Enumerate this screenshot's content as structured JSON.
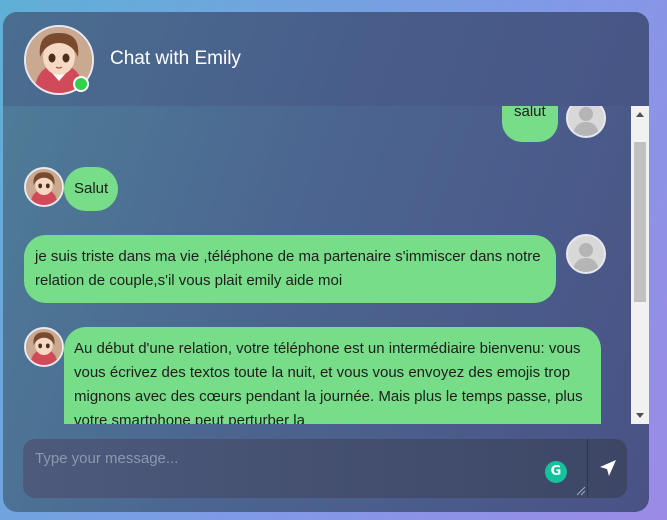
{
  "header": {
    "title": "Chat with Emily",
    "status": "online",
    "avatar_icon": "emily-avatar-icon"
  },
  "messages": [
    {
      "sender": "user",
      "text": "salut"
    },
    {
      "sender": "emily",
      "text": "Salut"
    },
    {
      "sender": "user",
      "text": "je suis triste dans ma vie ,téléphone de ma partenaire s'immiscer dans notre relation de couple,s'il vous plait emily aide moi"
    },
    {
      "sender": "emily",
      "text": "Au début d'une relation, votre téléphone est un intermédiaire bienvenu: vous vous écrivez des textos toute la nuit, et vous vous envoyez des emojis trop mignons avec des cœurs pendant la journée. Mais plus le temps passe, plus votre smartphone peut perturber la"
    }
  ],
  "composer": {
    "placeholder": "Type your message...",
    "value": "",
    "grammarly_icon": "grammarly-icon",
    "send_icon": "send-icon"
  },
  "colors": {
    "bubble": "#77dd88",
    "online": "#2fd24a",
    "text": "#1e1e1e"
  }
}
